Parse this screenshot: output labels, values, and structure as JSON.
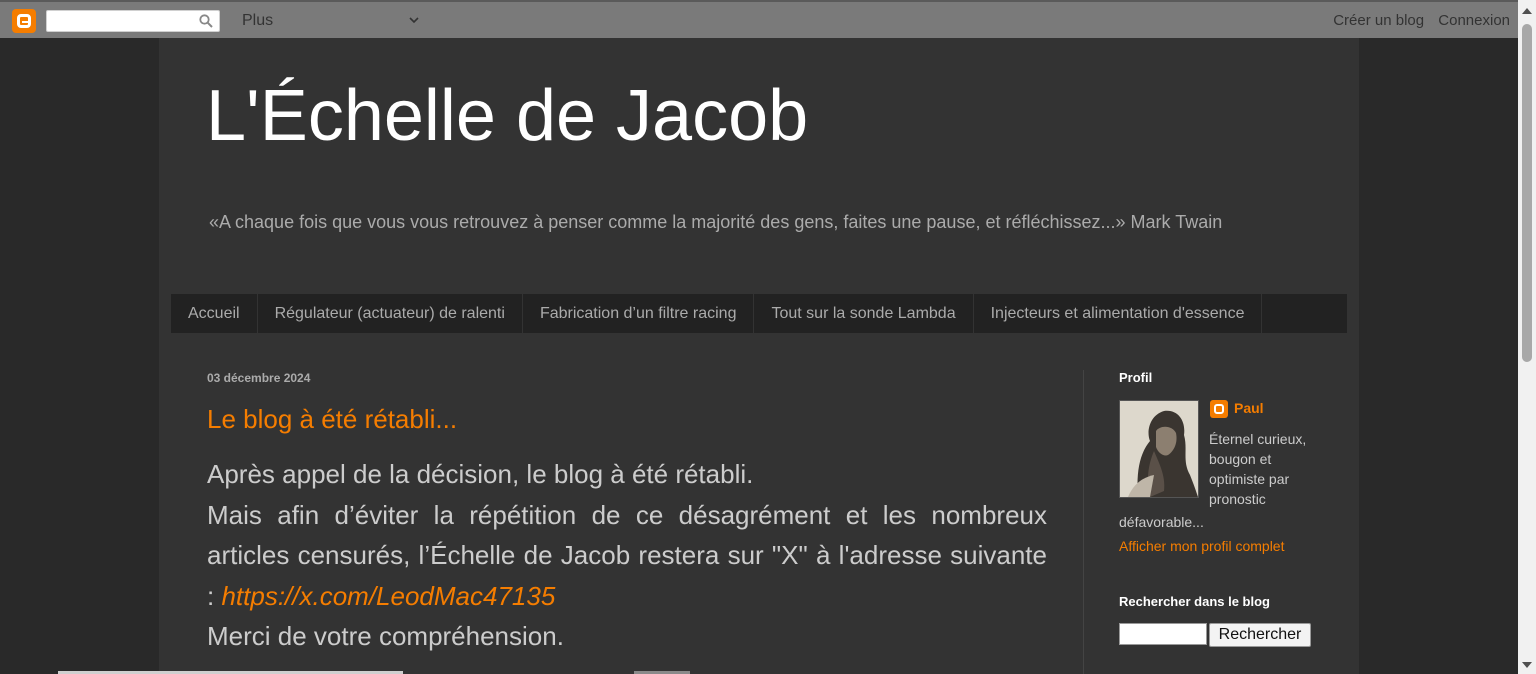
{
  "navbar": {
    "more_label": "Plus",
    "create_blog": "Créer un blog",
    "sign_in": "Connexion"
  },
  "blog": {
    "title": "L'Échelle de Jacob",
    "description": "«A chaque fois que vous vous retrouvez à penser comme la majorité des gens, faites une pause, et réfléchissez...» Mark Twain"
  },
  "tabs": [
    "Accueil",
    "Régulateur (actuateur) de ralenti",
    "Fabrication d’un filtre racing",
    "Tout sur la sonde Lambda",
    "Injecteurs et alimentation d'essence"
  ],
  "post": {
    "date": "03 décembre 2024",
    "title": "Le blog à été rétabli...",
    "line1": "Après appel de la décision, le blog à été rétabli.",
    "line2": "Mais afin d’éviter la répétition de ce désagrément et les nombreux articles censurés, l’Échelle de Jacob restera sur \"X\" à l'adresse suivante : ",
    "link": "https://x.com/LeodMac47135",
    "line3": "Merci de votre compréhension."
  },
  "sidebar": {
    "profile_heading": "Profil",
    "profile_name": "Paul",
    "about_part1": "Éternel curieux, bougon et optimiste par pronostic",
    "about_part2": "défavorable...",
    "profile_link": "Afficher mon profil complet",
    "search_heading": "Rechercher dans le blog",
    "search_button": "Rechercher"
  },
  "colors": {
    "accent": "#f57d00",
    "page_bg": "#292929",
    "content_bg": "#333333",
    "tabs_bg": "#222222"
  }
}
